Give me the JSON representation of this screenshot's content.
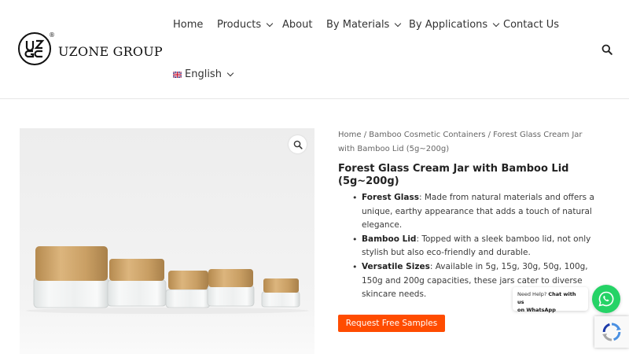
{
  "header": {
    "logo_text": "UZONE GROUP",
    "logo_mark": "logo-mark",
    "logo_registered": "®",
    "nav": [
      {
        "label": "Home",
        "dropdown": false
      },
      {
        "label": "Products",
        "dropdown": true
      },
      {
        "label": "About",
        "dropdown": false
      },
      {
        "label": "By Materials",
        "dropdown": true
      },
      {
        "label": "By Applications",
        "dropdown": true
      },
      {
        "label": "Contact Us",
        "dropdown": false
      }
    ],
    "language": {
      "label": "English",
      "icon": "uk-flag-icon"
    },
    "search_icon": "search-icon"
  },
  "product": {
    "image_icon": "zoom-icon",
    "breadcrumb": {
      "home": "Home",
      "sep": " / ",
      "category": "Bamboo Cosmetic Containers",
      "current": "Forest Glass Cream Jar with Bamboo Lid (5g~200g)"
    },
    "title": "Forest Glass Cream Jar with Bamboo Lid (5g~200g)",
    "features": [
      {
        "term": "Forest Glass",
        "desc": ": Made from natural materials and offers a unique, earthy appearance that adds a touch of natural elegance."
      },
      {
        "term": "Bamboo Lid",
        "desc": ": Topped with a sleek bamboo lid, not only stylish but also eco-friendly and durable."
      },
      {
        "term": "Versatile Sizes",
        "desc": ": Available in 5g, 15g, 30g, 50g, 100g, 150g and 200g capacities, these jars cater to diverse skincare needs."
      }
    ],
    "cta_label": "Request Free Samples"
  },
  "whatsapp": {
    "line1": "Need Help? ",
    "line1_bold": "Chat with us",
    "line2": "on WhatsApp",
    "icon": "whatsapp-icon"
  },
  "recaptcha_icon": "recaptcha-icon",
  "colors": {
    "accent": "#ff4c00",
    "whatsapp": "#25d366",
    "text": "#3a3a3a"
  }
}
